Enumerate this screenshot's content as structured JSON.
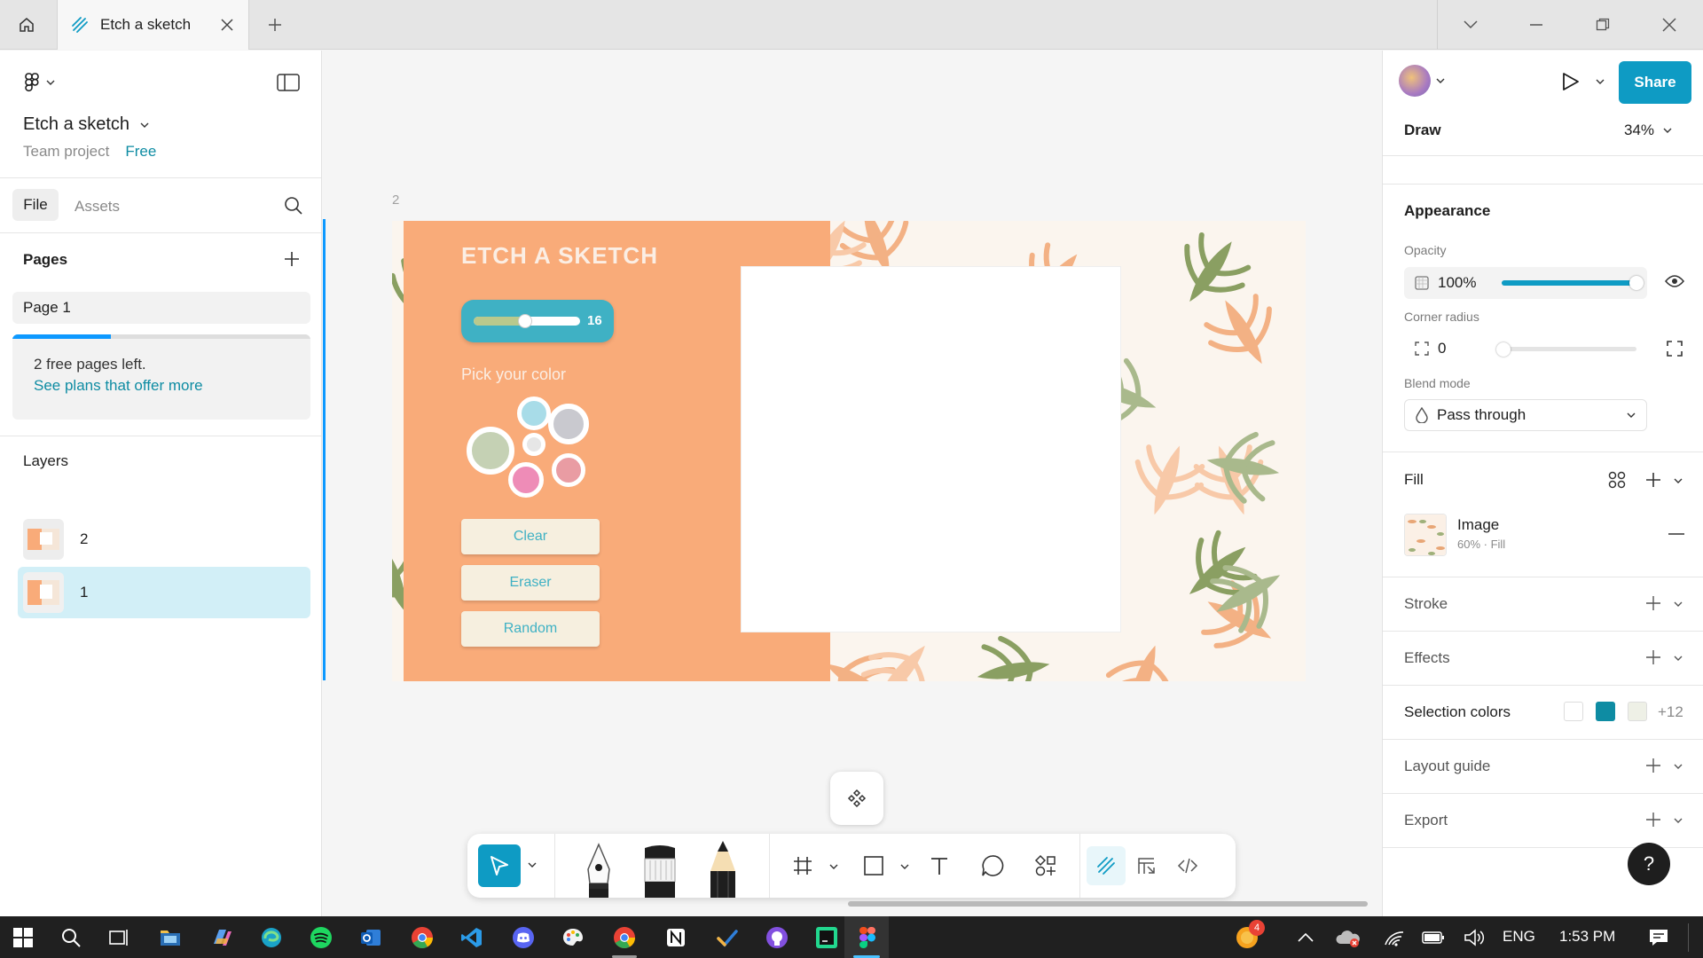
{
  "titlebar": {
    "tab_title": "Etch a sketch"
  },
  "left_panel": {
    "file_name": "Etch a sketch",
    "project": "Team project",
    "plan_badge": "Free",
    "tabs": [
      {
        "label": "File"
      },
      {
        "label": "Assets"
      }
    ],
    "pages_title": "Pages",
    "pages": [
      {
        "label": "Page 1"
      }
    ],
    "free_pages_text": "2 free pages left.",
    "plans_link": "See plans that offer more",
    "free_pages_progress": 0.33,
    "layers_title": "Layers",
    "layers": [
      {
        "label": "2"
      },
      {
        "label": "1"
      }
    ]
  },
  "canvas": {
    "frame_label": "2",
    "app": {
      "title": "ETCH A SKETCH",
      "slider_value": "16",
      "pick_color_label": "Pick your color",
      "buttons": [
        {
          "label": "Clear"
        },
        {
          "label": "Eraser"
        },
        {
          "label": "Random"
        }
      ],
      "swatches": [
        "#a8dce8",
        "#c9c9cf",
        "#c5d1b4",
        "#e6e6e6",
        "#e99ca3",
        "#ee8cb7"
      ]
    }
  },
  "right_panel": {
    "mode": "Draw",
    "zoom": "34%",
    "share_label": "Share",
    "appearance_title": "Appearance",
    "opacity_label": "Opacity",
    "opacity_value": "100%",
    "corner_radius_label": "Corner radius",
    "corner_radius_value": "0",
    "blend_mode_label": "Blend mode",
    "blend_mode_value": "Pass through",
    "fill_title": "Fill",
    "fill_name": "Image",
    "fill_detail": "60% · Fill",
    "stroke_title": "Stroke",
    "effects_title": "Effects",
    "selection_colors_title": "Selection colors",
    "selection_colors": [
      "#ffffff",
      "#0e8ca3",
      "#eef0e6"
    ],
    "selection_colors_more": "+12",
    "layout_guide_title": "Layout guide",
    "export_title": "Export",
    "help_label": "?"
  },
  "taskbar": {
    "language": "ENG",
    "time": "1:53 PM",
    "notification_badge": "4"
  },
  "colors": {
    "accent": "#0d99ff",
    "share_bg": "#0e9bc4",
    "app_orange": "#f9ab79",
    "app_teal": "#3fb1c4",
    "layer_selected": "#d2eff7"
  }
}
